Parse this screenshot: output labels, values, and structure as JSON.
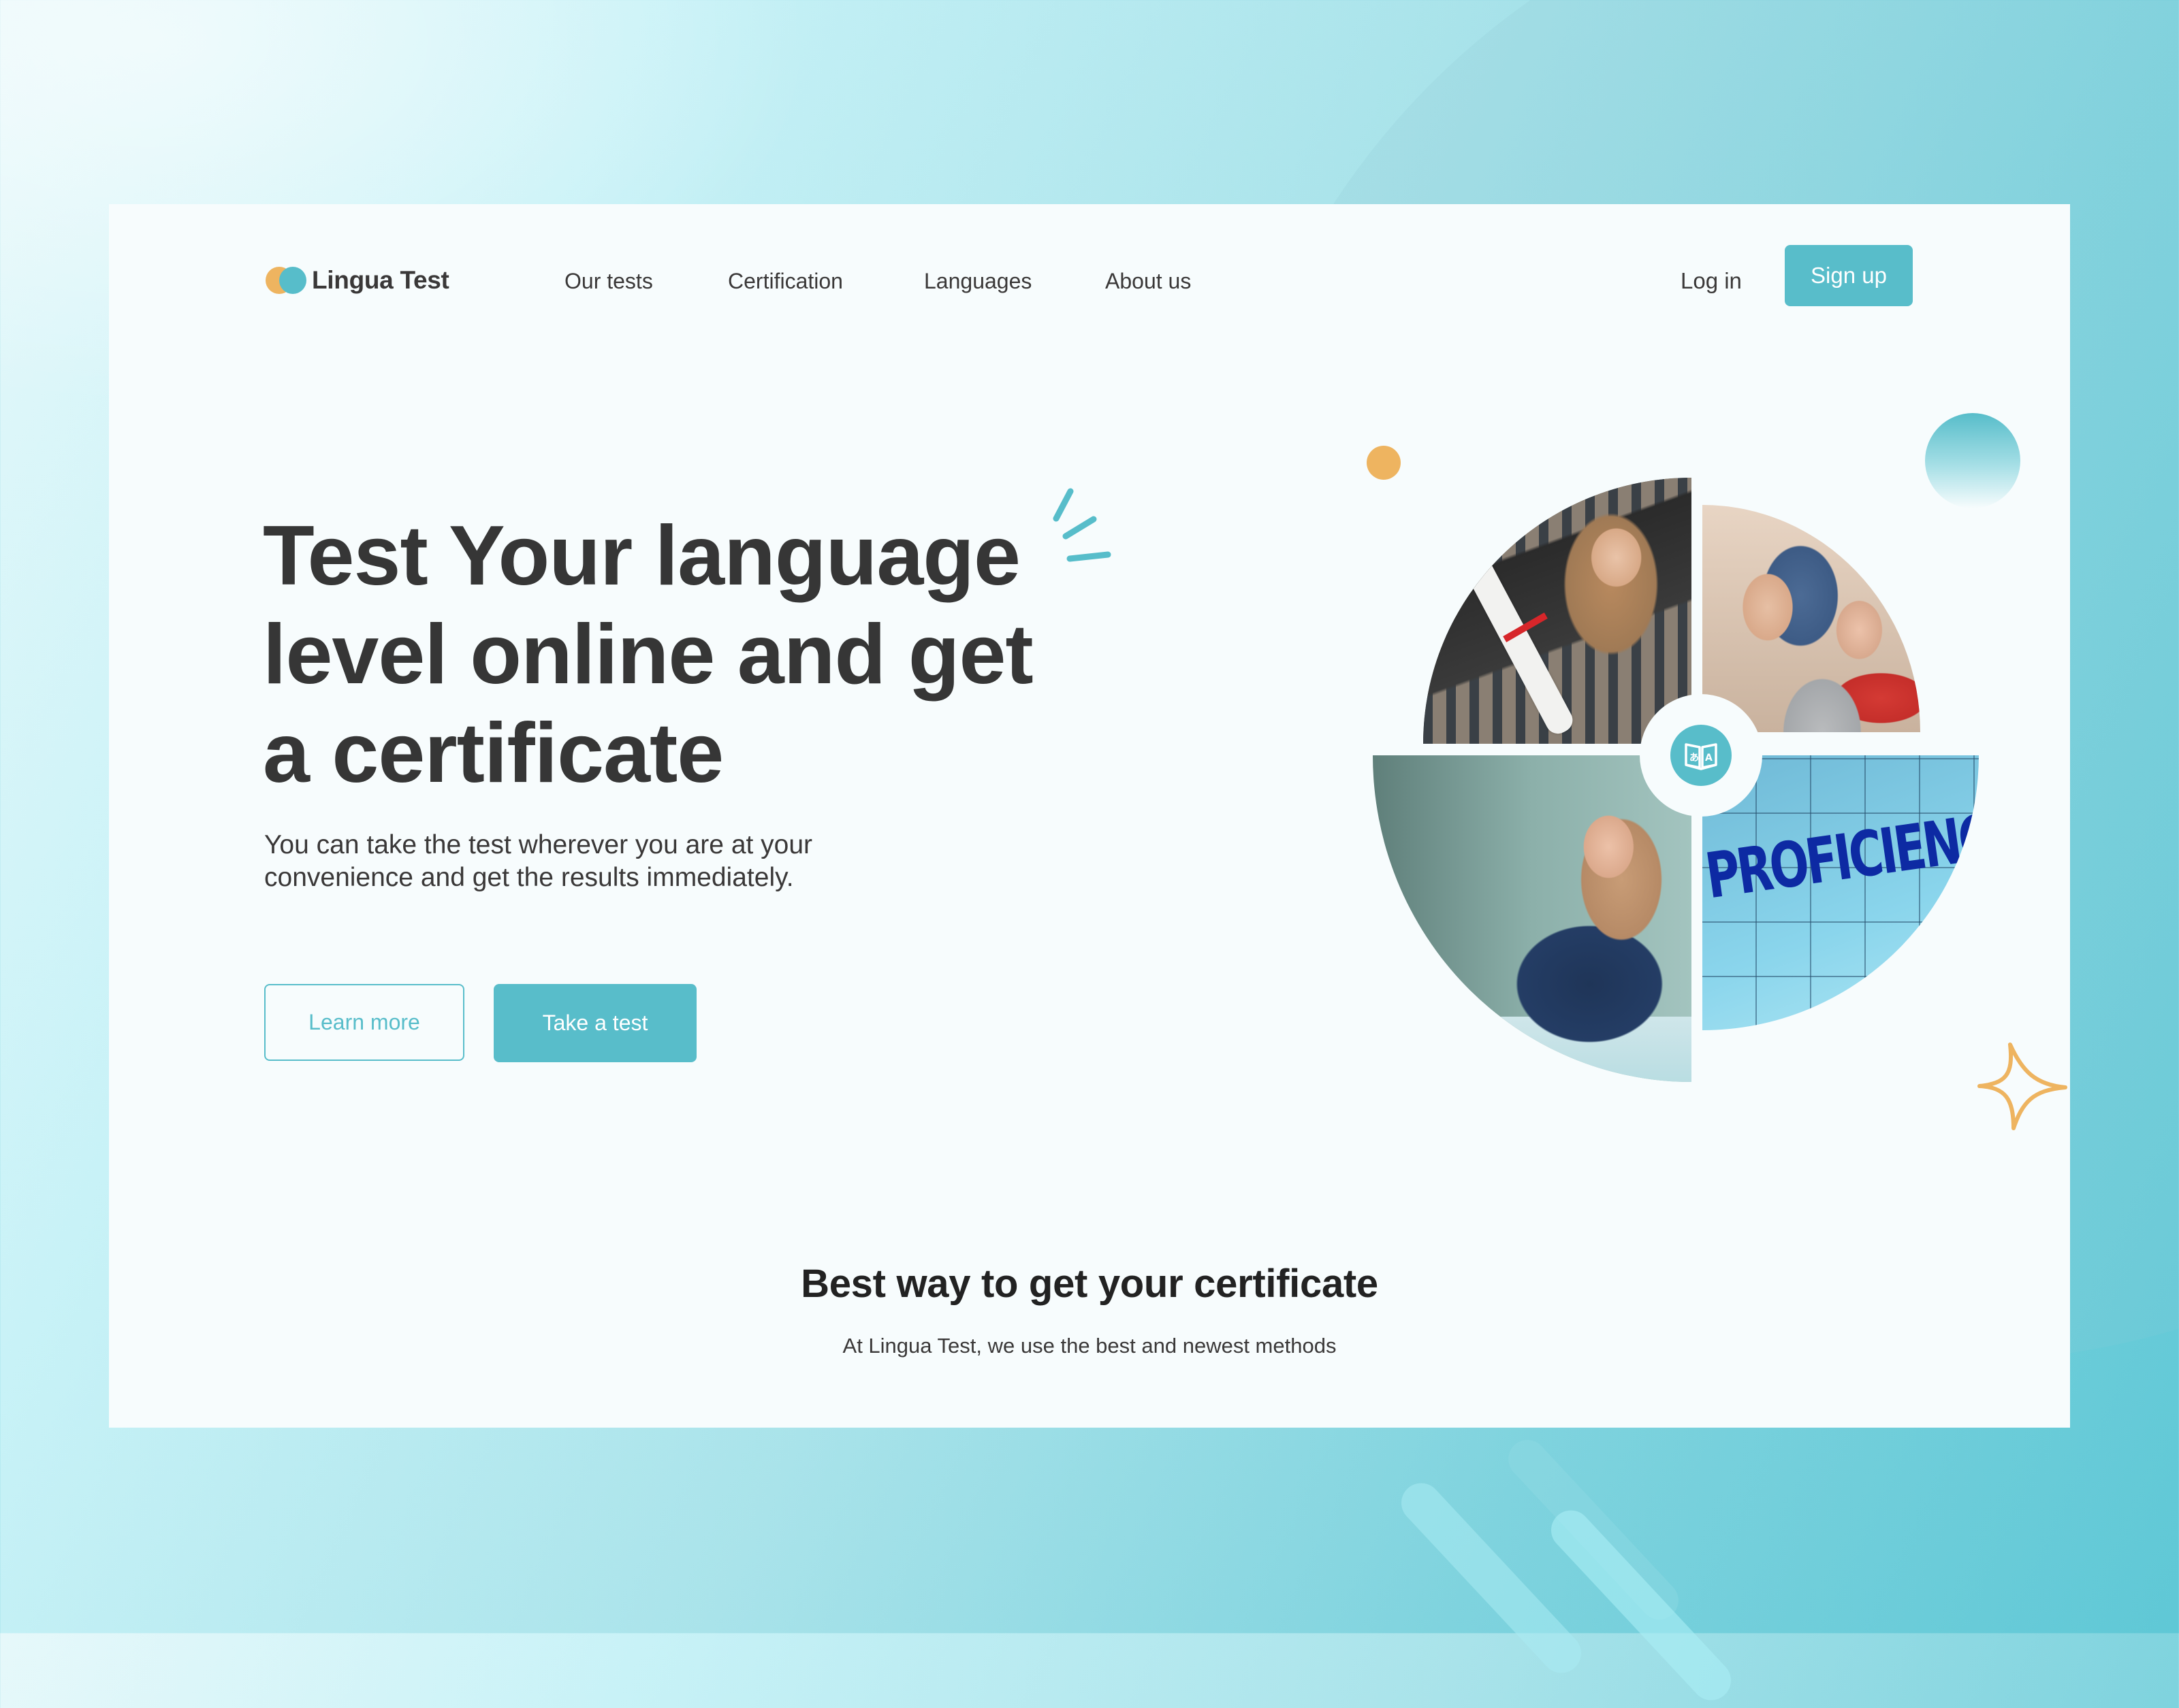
{
  "brand": {
    "name": "Lingua Test",
    "logo_icon": "two-overlapping-circles-icon"
  },
  "nav": {
    "items": [
      {
        "label": "Our tests"
      },
      {
        "label": "Certification"
      },
      {
        "label": "Languages"
      },
      {
        "label": "About us"
      }
    ],
    "login_label": "Log in",
    "signup_label": "Sign up"
  },
  "hero": {
    "title_lines": [
      "Test Your language",
      "level online and get",
      "a certificate"
    ],
    "subtitle_lines": [
      "You can take the test wherever you are at your",
      "convenience and get the results immediately."
    ],
    "learn_more_label": "Learn more",
    "take_test_label": "Take a test"
  },
  "collage": {
    "photos": [
      {
        "description": "graduate holding diploma"
      },
      {
        "description": "students at laptop"
      },
      {
        "description": "woman writing at desk"
      },
      {
        "description": "puzzle with proficiency word",
        "overlay_text": "PROFICIENCY"
      }
    ],
    "center_icon": "book-translate-icon"
  },
  "section": {
    "title": "Best way to get your certificate",
    "subtitle": "At Lingua Test, we use the best and newest methods"
  },
  "colors": {
    "accent": "#58bdca",
    "orange": "#eeb460",
    "text_dark": "#363636",
    "card_bg": "#f7fcfd"
  }
}
